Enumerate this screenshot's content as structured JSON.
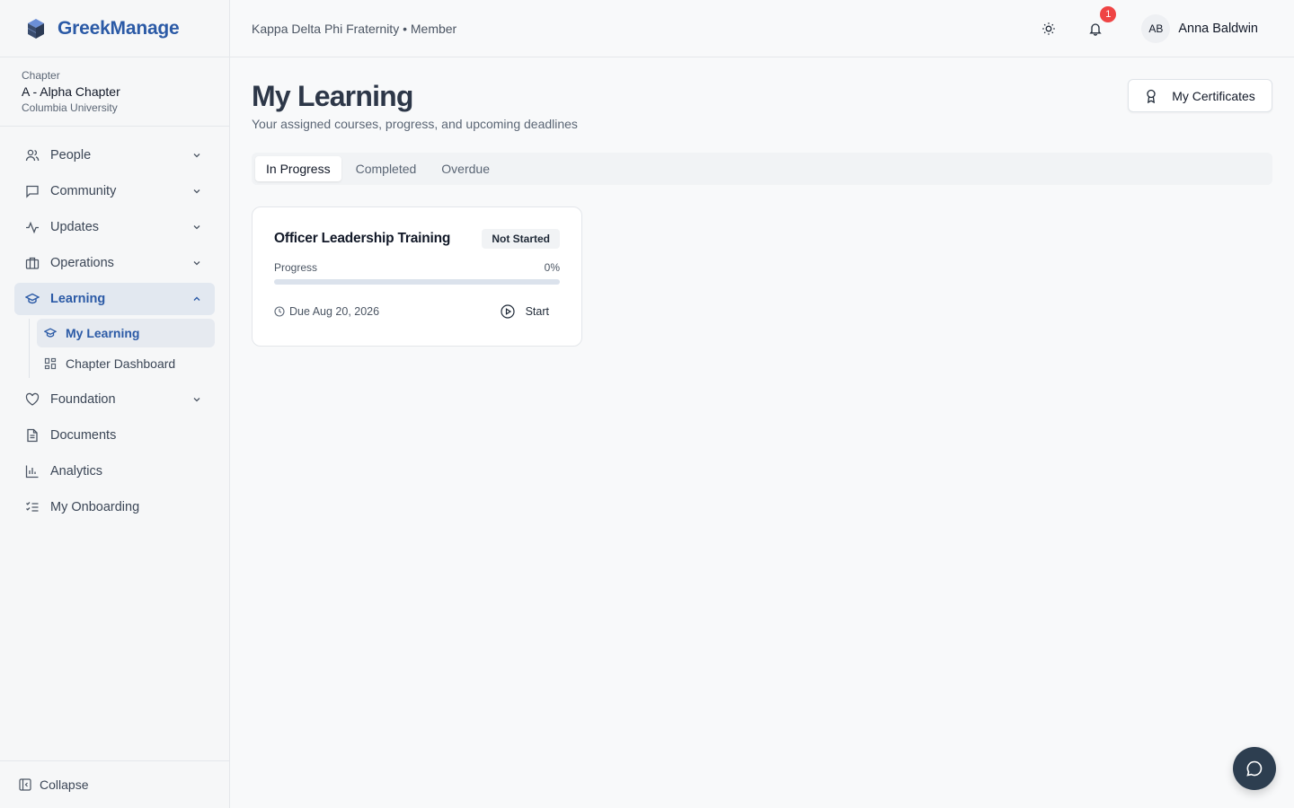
{
  "brand": {
    "name": "GreekManage"
  },
  "chapter": {
    "label": "Chapter",
    "name": "A - Alpha Chapter",
    "university": "Columbia University"
  },
  "header": {
    "org": "Kappa Delta Phi Fraternity • Member",
    "notification_count": "1",
    "user_initials": "AB",
    "user_name": "Anna Baldwin"
  },
  "sidebar": {
    "items": [
      {
        "label": "People",
        "icon": "people-icon"
      },
      {
        "label": "Community",
        "icon": "chat-icon"
      },
      {
        "label": "Updates",
        "icon": "activity-icon"
      },
      {
        "label": "Operations",
        "icon": "building-icon"
      },
      {
        "label": "Learning",
        "icon": "graduation-cap-icon"
      },
      {
        "label": "Foundation",
        "icon": "heart-icon"
      },
      {
        "label": "Documents",
        "icon": "document-icon"
      },
      {
        "label": "Analytics",
        "icon": "bar-chart-icon"
      },
      {
        "label": "My Onboarding",
        "icon": "checklist-icon"
      }
    ],
    "learning_sub": [
      {
        "label": "My Learning",
        "icon": "graduation-cap-icon"
      },
      {
        "label": "Chapter Dashboard",
        "icon": "grid-icon"
      }
    ],
    "collapse_label": "Collapse"
  },
  "main": {
    "title": "My Learning",
    "subtitle": "Your assigned courses, progress, and upcoming deadlines",
    "certificates_label": "My Certificates",
    "tabs": [
      {
        "label": "In Progress"
      },
      {
        "label": "Completed"
      },
      {
        "label": "Overdue"
      }
    ],
    "course": {
      "title": "Officer Leadership Training",
      "status": "Not Started",
      "progress_label": "Progress",
      "progress_text": "0%",
      "progress": 0,
      "due": "Due Aug 20, 2026",
      "action": "Start"
    }
  },
  "colors": {
    "accent": "#2b5aa6",
    "badge": "#ef4444",
    "chat": "#2d3e50"
  }
}
